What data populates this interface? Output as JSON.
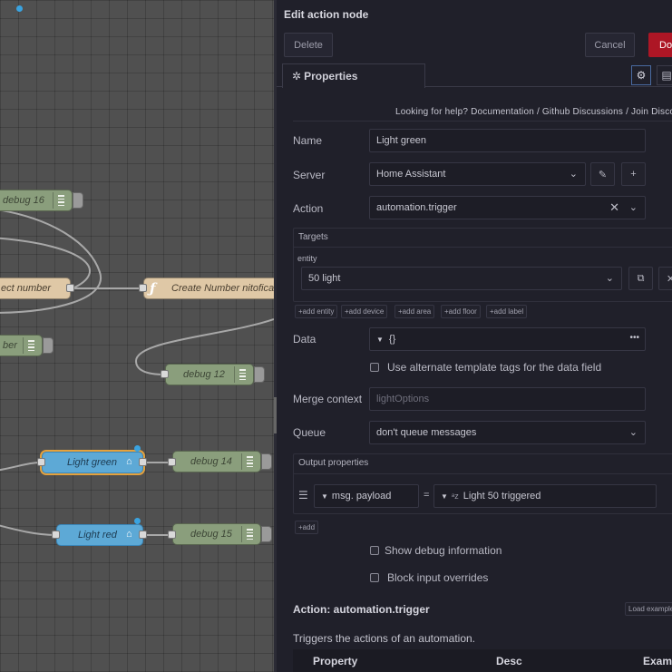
{
  "canvas": {
    "nodes": {
      "debug16": "debug 16",
      "select_number": "ect number",
      "create_number": "Create Number nitofica",
      "number": "ber",
      "debug12": "debug 12",
      "light_green": "Light green",
      "debug14": "debug 14",
      "light_red": "Light red",
      "debug15": "debug 15"
    }
  },
  "panel": {
    "title": "Edit action node",
    "delete_label": "Delete",
    "cancel_label": "Cancel",
    "done_label": "Done",
    "tab_properties": "Properties",
    "help_text": "Looking for help? Documentation / Github Discussions / Join Discord",
    "fields": {
      "name_label": "Name",
      "name_value": "Light green",
      "server_label": "Server",
      "server_value": "Home Assistant",
      "action_label": "Action",
      "action_value": "automation.trigger",
      "targets_label": "Targets",
      "entity_label": "entity",
      "entity_value": "50 light",
      "add_entity": "add entity",
      "add_device": "add device",
      "add_area": "add area",
      "add_floor": "add floor",
      "add_label": "add label",
      "data_label": "Data",
      "data_value": "{}",
      "alt_template_label": "Use alternate template tags for the data field",
      "merge_context_label": "Merge context",
      "merge_context_placeholder": "lightOptions",
      "queue_label": "Queue",
      "queue_value": "don't queue messages",
      "output_properties_label": "Output properties",
      "output_property": "msg. payload",
      "output_equals": "=",
      "output_value": "Light 50 triggered",
      "add_button": "add",
      "show_debug_label": "Show debug information",
      "block_overrides_label": "Block input overrides"
    },
    "doc": {
      "heading": "Action: automation.trigger",
      "load_example": "Load example",
      "description": "Triggers the actions of an automation.",
      "col_property": "Property",
      "col_desc": "Desc",
      "col_example": "Example"
    }
  }
}
